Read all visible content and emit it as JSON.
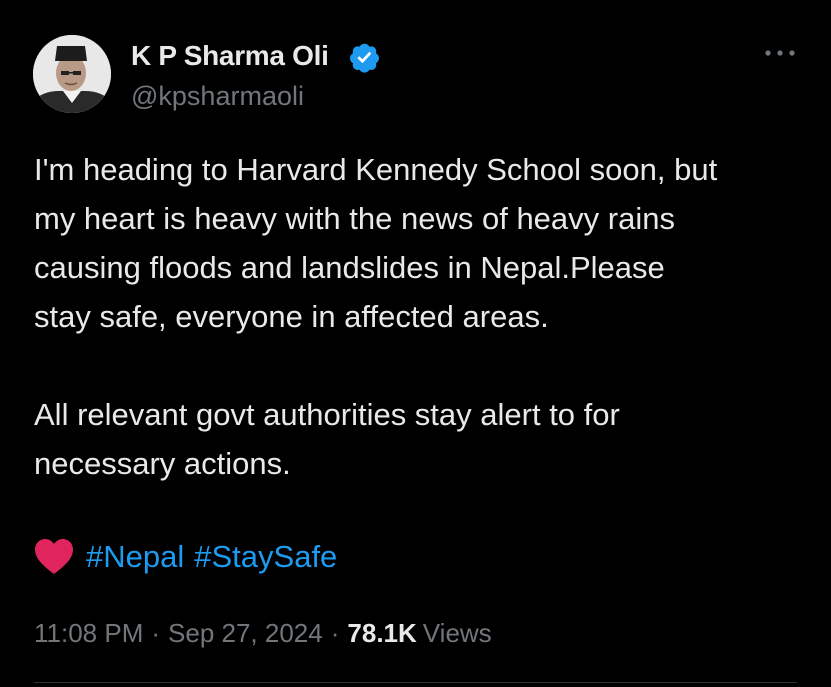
{
  "author": {
    "display_name": "K P Sharma Oli",
    "handle": "@kpsharmaoli",
    "verified": true,
    "verified_color": "#1d9bf0"
  },
  "tweet": {
    "paragraph1": [
      "I'm heading to Harvard Kennedy School soon, but",
      "my heart is heavy with the news of heavy rains",
      "causing floods and landslides in Nepal.Please",
      "stay safe, everyone in affected areas."
    ],
    "paragraph2": [
      "All relevant govt authorities stay alert to for",
      "necessary actions."
    ],
    "emoji": "heart-emoji",
    "hashtags": [
      "#Nepal",
      "#StaySafe"
    ]
  },
  "meta": {
    "time": "11:08 PM",
    "separator": "·",
    "date": "Sep 27, 2024",
    "views_count": "78.1K",
    "views_label": "Views"
  },
  "colors": {
    "background": "#000000",
    "text": "#e7e9ea",
    "secondary": "#71767b",
    "link": "#1d9bf0",
    "heart": "#e0245e"
  }
}
